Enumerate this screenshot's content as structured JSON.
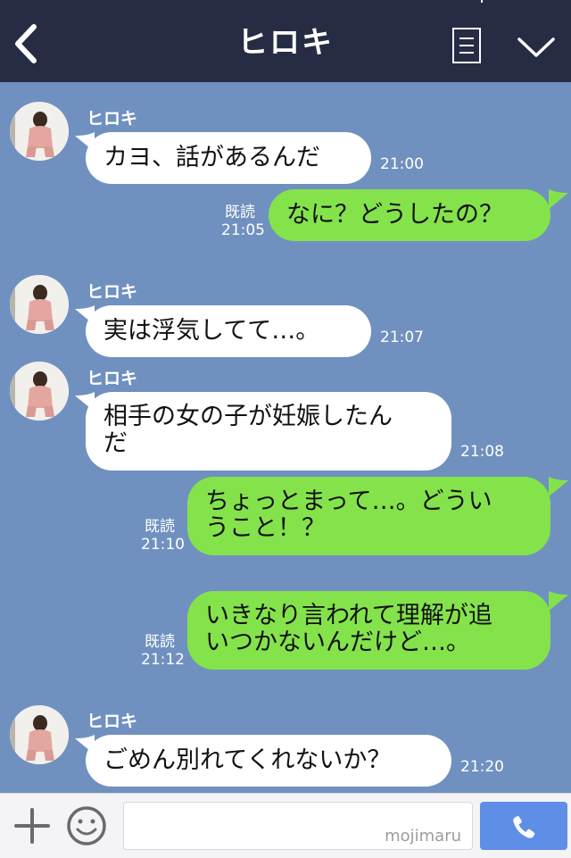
{
  "header": {
    "title": "ヒロキ"
  },
  "contact": {
    "name": "ヒロキ"
  },
  "messages": [
    {
      "side": "left",
      "text": "カヨ、話があるんだ",
      "time": "21:00"
    },
    {
      "side": "right",
      "text": "なに？どうしたの？",
      "read": "既読",
      "time": "21:05"
    },
    {
      "side": "left",
      "text": "実は浮気してて…。",
      "time": "21:07"
    },
    {
      "side": "left",
      "text_line1": "相手の女の子が妊娠したん",
      "text_line2": "だ",
      "time": "21:08"
    },
    {
      "side": "right",
      "text_line1": "ちょっとまって…。どうい",
      "text_line2": "うこと！？",
      "read": "既読",
      "time": "21:10"
    },
    {
      "side": "right",
      "text_line1": "いきなり言われて理解が追",
      "text_line2": "いつかないんだけど…。",
      "read": "既読",
      "time": "21:12"
    },
    {
      "side": "left",
      "text": "ごめん別れてくれないか？",
      "time": "21:20"
    }
  ],
  "input": {
    "placeholder": "",
    "watermark": "mojimaru"
  },
  "icons": {
    "back": "chevron-left-icon",
    "menu": "menu-list-icon",
    "dropdown": "chevron-down-icon",
    "plus": "plus-icon",
    "emoji": "emoji-icon",
    "send": "phone-icon"
  },
  "colors": {
    "header": "#252c43",
    "background": "#7091c0",
    "bubble_left": "#ffffff",
    "bubble_right": "#84e34b",
    "send_button": "#5f8ee6"
  }
}
